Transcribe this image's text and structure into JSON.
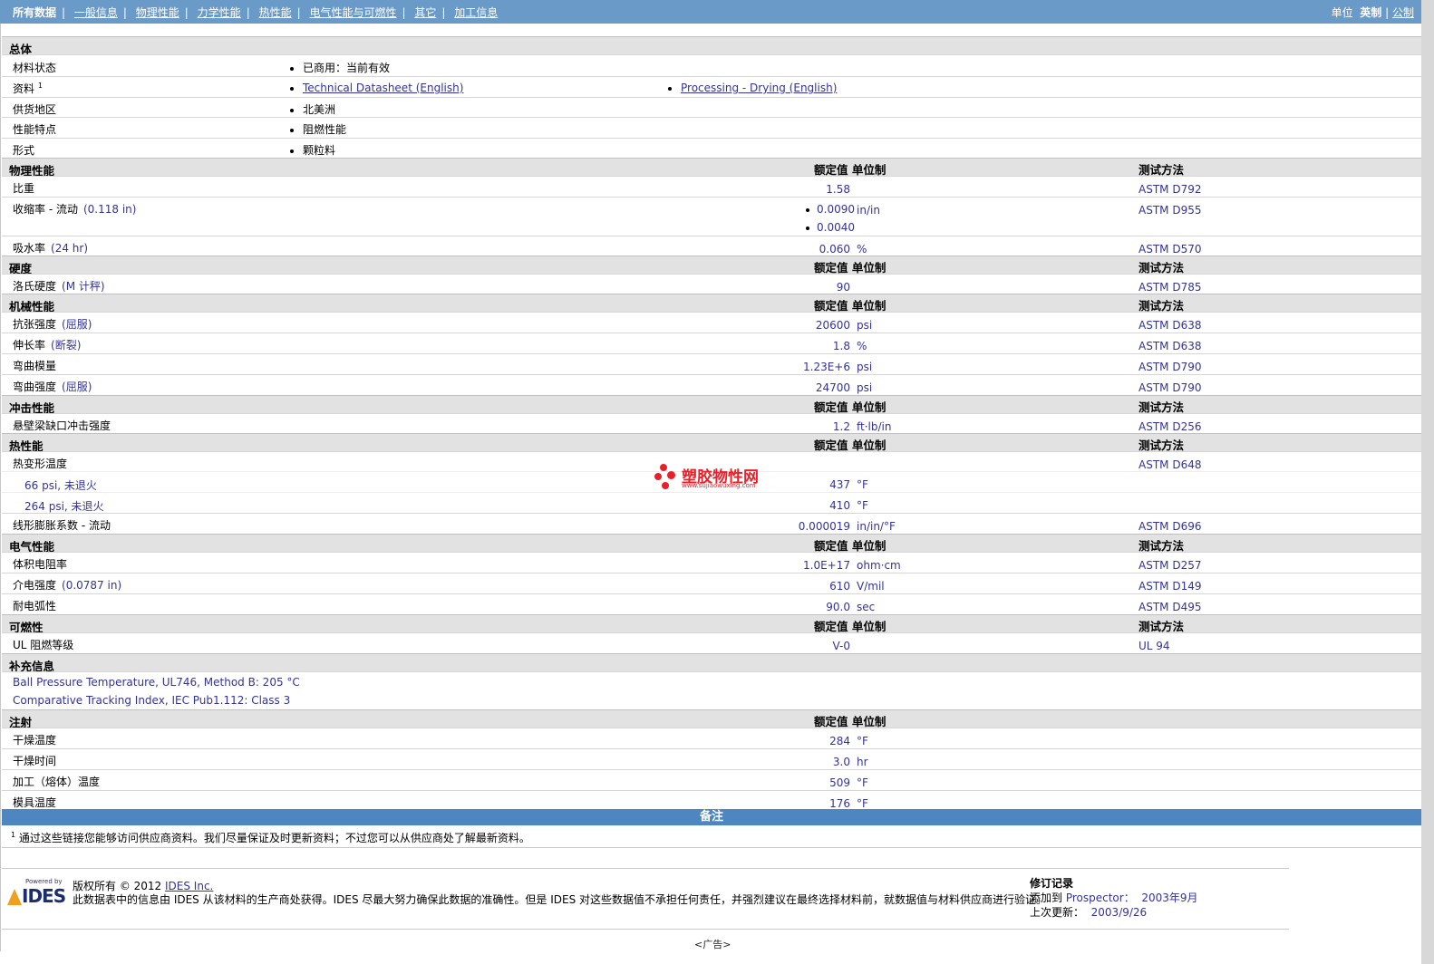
{
  "nav": {
    "items": [
      "所有数据",
      "一般信息",
      "物理性能",
      "力学性能",
      "热性能",
      "电气性能与可燃性",
      "其它",
      "加工信息"
    ],
    "units_label": "单位",
    "units_english": "英制",
    "units_metric": "公制"
  },
  "general": {
    "title": "总体",
    "rows": [
      {
        "label": "材料状态",
        "values": [
          "已商用：当前有效"
        ]
      },
      {
        "label": "资料",
        "sup": "1",
        "links": [
          "Technical Datasheet (English)",
          "Processing - Drying (English)"
        ]
      },
      {
        "label": "供货地区",
        "values": [
          "北美洲"
        ]
      },
      {
        "label": "性能特点",
        "values": [
          "阻燃性能"
        ]
      },
      {
        "label": "形式",
        "values": [
          "颗粒料"
        ]
      }
    ]
  },
  "headers": {
    "nominal": "额定值",
    "unit": "单位制",
    "method": "测试方法"
  },
  "sections": {
    "physical": {
      "title": "物理性能",
      "rows": [
        {
          "label": "比重",
          "value": "1.58",
          "unit": "",
          "method": "ASTM D792"
        },
        {
          "label": "收缩率 - 流动",
          "cond": "(0.118 in)",
          "values": [
            "0.0090",
            "0.0040"
          ],
          "unit": "in/in",
          "method": "ASTM D955"
        },
        {
          "label": "吸水率",
          "cond": "(24 hr)",
          "value": "0.060",
          "unit": "%",
          "method": "ASTM D570"
        }
      ]
    },
    "hardness": {
      "title": "硬度",
      "rows": [
        {
          "label": "洛氏硬度",
          "cond": "(M 计秤)",
          "value": "90",
          "unit": "",
          "method": "ASTM D785"
        }
      ]
    },
    "mechanical": {
      "title": "机械性能",
      "rows": [
        {
          "label": "抗张强度",
          "cond": "(屈服)",
          "value": "20600",
          "unit": "psi",
          "method": "ASTM D638"
        },
        {
          "label": "伸长率",
          "cond": "(断裂)",
          "value": "1.8",
          "unit": "%",
          "method": "ASTM D638"
        },
        {
          "label": "弯曲模量",
          "value": "1.23E+6",
          "unit": "psi",
          "method": "ASTM D790"
        },
        {
          "label": "弯曲强度",
          "cond": "(屈服)",
          "value": "24700",
          "unit": "psi",
          "method": "ASTM D790"
        }
      ]
    },
    "impact": {
      "title": "冲击性能",
      "rows": [
        {
          "label": "悬壁梁缺口冲击强度",
          "value": "1.2",
          "unit": "ft·lb/in",
          "method": "ASTM D256"
        }
      ]
    },
    "thermal": {
      "title": "热性能",
      "rows": [
        {
          "label": "热变形温度",
          "method": "ASTM D648"
        },
        {
          "sub": "66 psi, 未退火",
          "value": "437",
          "unit": "°F"
        },
        {
          "sub": "264 psi, 未退火",
          "value": "410",
          "unit": "°F"
        },
        {
          "label": "线形膨胀系数 - 流动",
          "value": "0.000019",
          "unit": "in/in/°F",
          "method": "ASTM D696"
        }
      ]
    },
    "electrical": {
      "title": "电气性能",
      "rows": [
        {
          "label": "体积电阻率",
          "value": "1.0E+17",
          "unit": "ohm·cm",
          "method": "ASTM D257"
        },
        {
          "label": "介电强度",
          "cond": "(0.0787 in)",
          "value": "610",
          "unit": "V/mil",
          "method": "ASTM D149"
        },
        {
          "label": "耐电弧性",
          "value": "90.0",
          "unit": "sec",
          "method": "ASTM D495"
        }
      ]
    },
    "flammability": {
      "title": "可燃性",
      "rows": [
        {
          "label": "UL 阻燃等级",
          "value": "V-0",
          "unit": "",
          "method": "UL 94"
        }
      ]
    },
    "supplemental": {
      "title": "补充信息",
      "lines": [
        "Ball Pressure Temperature, UL746, Method B: 205 °C",
        "Comparative Tracking Index, IEC Pub1.112: Class 3"
      ]
    },
    "injection": {
      "title": "注射",
      "rows": [
        {
          "label": "干燥温度",
          "value": "284",
          "unit": "°F"
        },
        {
          "label": "干燥时间",
          "value": "3.0",
          "unit": "hr"
        },
        {
          "label": "加工（熔体）温度",
          "value": "509",
          "unit": "°F"
        },
        {
          "label": "模具温度",
          "value": "176",
          "unit": "°F"
        }
      ]
    }
  },
  "remarks": {
    "title": "备注",
    "note_sup": "1",
    "note": "通过这些链接您能够访问供应商资料。我们尽量保证及时更新资料；不过您可以从供应商处了解最新资料。"
  },
  "footer": {
    "logo_powered": "Powered by",
    "logo_name": "IDES",
    "copyright": "版权所有 © 2012",
    "company_link": "IDES Inc.",
    "disclaimer": "此数据表中的信息由 IDES 从该材料的生产商处获得。IDES 尽最大努力确保此数据的准确性。但是 IDES 对这些数据值不承担任何责任，并强烈建议在最终选择材料前，就数据值与材料供应商进行验证。",
    "revision_title": "修订记录",
    "added_label": "添加到",
    "added_where": "Prospector：",
    "added_date": "2003年9月",
    "updated_label": "上次更新：",
    "updated_date": "2003/9/26"
  },
  "ad": "<广告>",
  "watermark": {
    "name": "塑胶物性网",
    "url": "www.sujiaowuxing.com",
    "color": "#e8202a"
  }
}
